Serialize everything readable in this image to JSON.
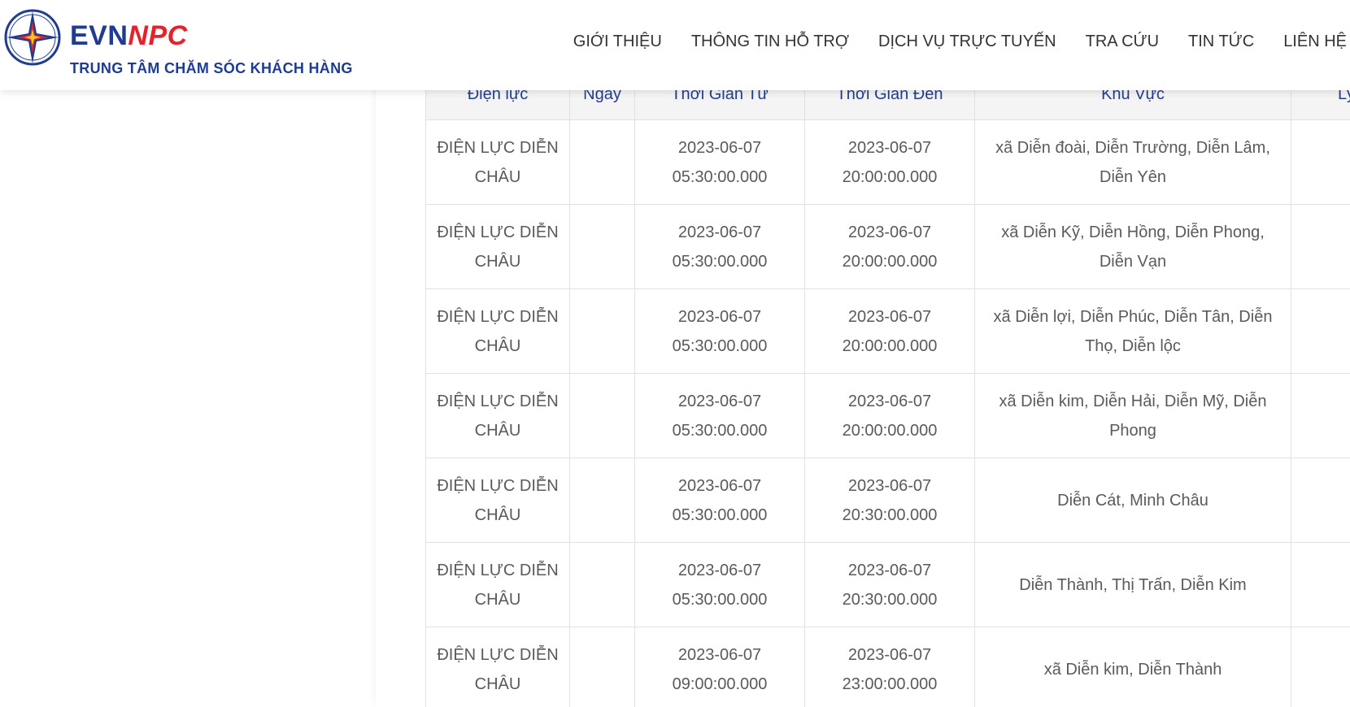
{
  "header": {
    "brand_evn": "EVN",
    "brand_npc": "NPC",
    "tagline": "TRUNG TÂM CHĂM SÓC KHÁCH HÀNG",
    "logo_icon": "evn-star-compass-logo",
    "nav": [
      "GIỚI THIỆU",
      "THÔNG TIN HỖ TRỢ",
      "DỊCH VỤ TRỰC TUYẾN",
      "TRA CỨU",
      "TIN TỨC",
      "LIÊN HỆ"
    ]
  },
  "table": {
    "columns": [
      "Điện lực",
      "Ngày",
      "Thời Gian Từ",
      "Thời Gian Đến",
      "Khu Vực",
      "Lý"
    ],
    "rows": [
      {
        "dienluc": "ĐIỆN LỰC DIỄN CHÂU",
        "ngay": "",
        "tu": "2023-06-07 05:30:00.000",
        "den": "2023-06-07 20:00:00.000",
        "khuvuc": "xã Diễn đoài, Diễn Trường, Diễn Lâm, Diễn Yên",
        "ly": ""
      },
      {
        "dienluc": "ĐIỆN LỰC DIỄN CHÂU",
        "ngay": "",
        "tu": "2023-06-07 05:30:00.000",
        "den": "2023-06-07 20:00:00.000",
        "khuvuc": "xã Diễn Kỹ, Diễn Hồng, Diễn Phong, Diễn Vạn",
        "ly": ""
      },
      {
        "dienluc": "ĐIỆN LỰC DIỄN CHÂU",
        "ngay": "",
        "tu": "2023-06-07 05:30:00.000",
        "den": "2023-06-07 20:00:00.000",
        "khuvuc": "xã Diễn lợi, Diễn Phúc, Diễn Tân, Diễn Thọ, Diễn lộc",
        "ly": ""
      },
      {
        "dienluc": "ĐIỆN LỰC DIỄN CHÂU",
        "ngay": "",
        "tu": "2023-06-07 05:30:00.000",
        "den": "2023-06-07 20:00:00.000",
        "khuvuc": "xã Diễn kim, Diễn Hải, Diễn Mỹ, Diễn Phong",
        "ly": ""
      },
      {
        "dienluc": "ĐIỆN LỰC DIỄN CHÂU",
        "ngay": "",
        "tu": "2023-06-07 05:30:00.000",
        "den": "2023-06-07 20:30:00.000",
        "khuvuc": "Diễn Cát, Minh Châu",
        "ly": ""
      },
      {
        "dienluc": "ĐIỆN LỰC DIỄN CHÂU",
        "ngay": "",
        "tu": "2023-06-07 05:30:00.000",
        "den": "2023-06-07 20:30:00.000",
        "khuvuc": "Diễn Thành, Thị Trấn, Diễn Kim",
        "ly": ""
      },
      {
        "dienluc": "ĐIỆN LỰC DIỄN CHÂU",
        "ngay": "",
        "tu": "2023-06-07 09:00:00.000",
        "den": "2023-06-07 23:00:00.000",
        "khuvuc": "xã Diễn kim, Diễn Thành",
        "ly": ""
      }
    ]
  },
  "colors": {
    "brand_blue": "#1f3c8f",
    "brand_red": "#e3232b",
    "header_text": "#233e8b",
    "cell_text": "#5a5a5a",
    "grid": "#e1e1e1"
  }
}
